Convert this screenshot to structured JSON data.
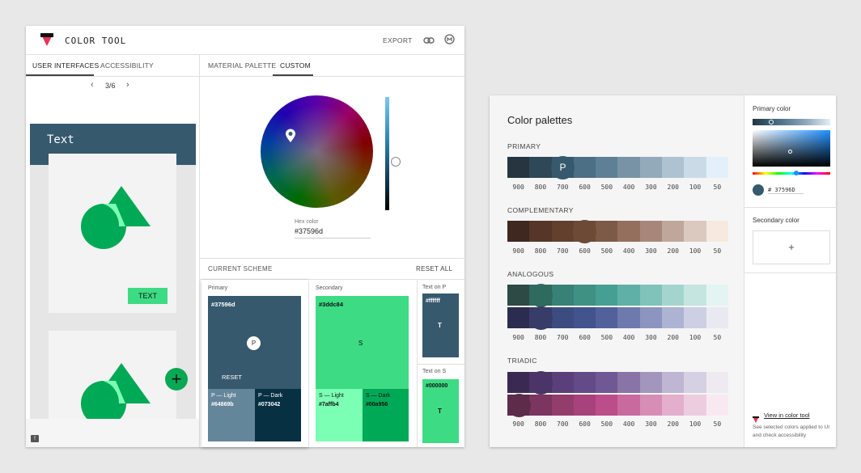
{
  "left_app": {
    "title": "COLOR TOOL",
    "toolbar": {
      "export": "EXPORT",
      "link_icon": "link-icon",
      "github_icon": "github-icon"
    },
    "tabs_left": [
      "USER INTERFACES",
      "ACCESSIBILITY"
    ],
    "tabs_right": [
      "MATERIAL PALETTE",
      "CUSTOM"
    ],
    "pager": "3/6",
    "preview": {
      "header_text": "Text",
      "button_text": "TEXT",
      "fab_icon": "plus-icon",
      "feedback_icon": "feedback-icon"
    },
    "picker": {
      "hex_label": "Hex color",
      "hex_value": "#37596d"
    },
    "scheme": {
      "title": "CURRENT SCHEME",
      "reset_all": "RESET ALL",
      "primary": {
        "label": "Primary",
        "hex": "#37596d",
        "badge": "P",
        "reset": "RESET",
        "light": {
          "label": "P — Light",
          "hex": "#64869b"
        },
        "dark": {
          "label": "P — Dark",
          "hex": "#073042"
        }
      },
      "secondary": {
        "label": "Secondary",
        "hex": "#3ddc84",
        "badge": "S",
        "light": {
          "label": "S — Light",
          "hex": "#7affb4"
        },
        "dark": {
          "label": "S — Dark",
          "hex": "#00a956"
        }
      },
      "text_on_p": {
        "label": "Text on P",
        "hex": "#ffffff",
        "letter": "T"
      },
      "text_on_s": {
        "label": "Text on S",
        "hex": "#000000",
        "letter": "T"
      }
    }
  },
  "right_app": {
    "title": "Color palettes",
    "shades": [
      "900",
      "800",
      "700",
      "600",
      "500",
      "400",
      "300",
      "200",
      "100",
      "50"
    ],
    "primary": {
      "label": "PRIMARY",
      "badge": "P",
      "colors": [
        "#263540",
        "#2f4858",
        "#37596d",
        "#4c6f86",
        "#5e7f95",
        "#7893a6",
        "#93aabb",
        "#afc2d1",
        "#cadbe7",
        "#e4f0f9"
      ]
    },
    "complementary": {
      "label": "COMPLEMENTARY",
      "colors": [
        "#3e2820",
        "#563628",
        "#633f2e",
        "#6d4a36",
        "#7d5a47",
        "#946f5d",
        "#a8877a",
        "#c0a79c",
        "#dbc8bf",
        "#f5e9e0"
      ]
    },
    "analogous": {
      "label": "ANALOGOUS",
      "row1": [
        "#2e4a45",
        "#2f6a5e",
        "#388176",
        "#3f9184",
        "#469f93",
        "#5fb0a6",
        "#7fc3ba",
        "#a3d5ce",
        "#c5e5e1",
        "#e4f4f2"
      ],
      "row2": [
        "#2c2b50",
        "#383c68",
        "#3d4c80",
        "#43538e",
        "#52609c",
        "#6e79ad",
        "#8c95c0",
        "#adb3d3",
        "#cdd0e3",
        "#e9eaf1"
      ]
    },
    "triadic": {
      "label": "TRIADIC",
      "row1": [
        "#3a2a52",
        "#4a3468",
        "#5a3f7a",
        "#634a88",
        "#705894",
        "#8874a7",
        "#a296bd",
        "#beb6d3",
        "#d6d0e3",
        "#edeaf2"
      ],
      "row2": [
        "#5c2c4a",
        "#7a3560",
        "#933d6d",
        "#a8427c",
        "#bb4d8a",
        "#c96a9e",
        "#d68eb7",
        "#e3afcc",
        "#eecce0",
        "#f8e9f0"
      ]
    },
    "side": {
      "primary_label": "Primary color",
      "hex": "# 37596D",
      "secondary_label": "Secondary color",
      "add": "+",
      "link": "View in color tool",
      "note": "See selected colors applied to UI and check accessibility"
    }
  },
  "colors": {
    "primary": "#37596d",
    "secondary": "#3ddc84",
    "accent_green": "#0aa854",
    "logo_red": "#e8325a"
  }
}
